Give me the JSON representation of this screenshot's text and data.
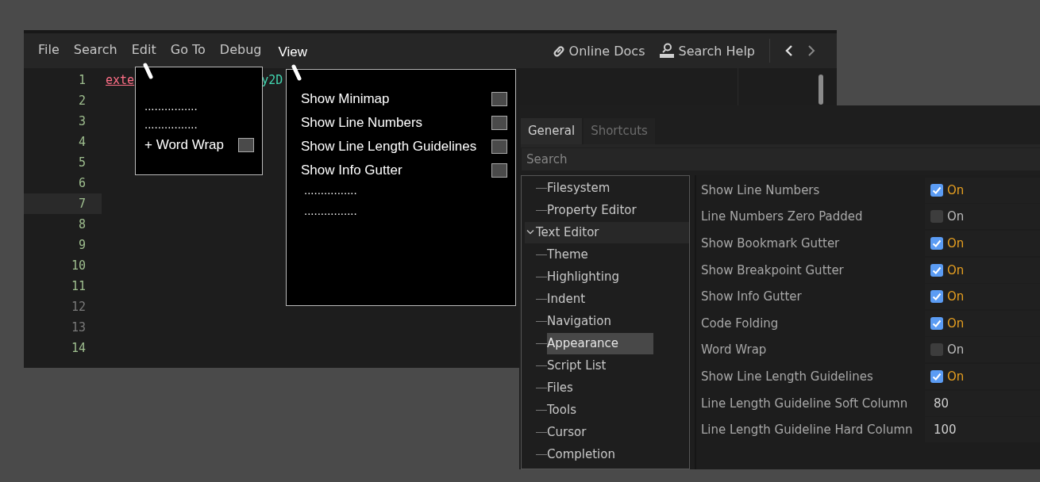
{
  "editor": {
    "menu": [
      {
        "label": "File"
      },
      {
        "label": "Search"
      },
      {
        "label": "Edit"
      },
      {
        "label": "Go To"
      },
      {
        "label": "Debug"
      },
      {
        "label": "View"
      }
    ],
    "help_links": [
      {
        "kind": "link",
        "label": "Online Docs"
      },
      {
        "kind": "doc",
        "label": "Search Help"
      }
    ],
    "line_numbers": [
      {
        "text": "1",
        "color": "#9fbf8f",
        "selected": false
      },
      {
        "text": "2",
        "color": "#9fbf8f",
        "selected": false
      },
      {
        "text": "3",
        "color": "#9fbf8f",
        "selected": false
      },
      {
        "text": "4",
        "color": "#9fbf8f",
        "selected": false
      },
      {
        "text": "5",
        "color": "#9fbf8f",
        "selected": false
      },
      {
        "text": "6",
        "color": "#9fbf8f",
        "selected": false
      },
      {
        "text": "7",
        "color": "#9fbf8f",
        "selected": true
      },
      {
        "text": "8",
        "color": "#9fbf8f",
        "selected": false
      },
      {
        "text": "9",
        "color": "#9fbf8f",
        "selected": false
      },
      {
        "text": "10",
        "color": "#9fbf8f",
        "selected": false
      },
      {
        "text": "11",
        "color": "#9fbf8f",
        "selected": false
      },
      {
        "text": "12",
        "color": "#7a7a7a",
        "selected": false
      },
      {
        "text": "13",
        "color": "#7a7a7a",
        "selected": false
      },
      {
        "text": "14",
        "color": "#9fbf8f",
        "selected": false
      }
    ],
    "code_line_1": {
      "keyword": "exte",
      "type": "y2D"
    }
  },
  "edit_popup": {
    "items": [
      {
        "kind": "dots",
        "label": "................"
      },
      {
        "kind": "dots",
        "label": "................"
      },
      {
        "kind": "check",
        "label": "+ Word Wrap",
        "checked": false
      }
    ]
  },
  "view_popup": {
    "items": [
      {
        "kind": "check",
        "label": "Show Minimap",
        "checked": false
      },
      {
        "kind": "check",
        "label": "Show Line Numbers",
        "checked": false
      },
      {
        "kind": "check",
        "label": "Show Line Length Guidelines",
        "checked": false
      },
      {
        "kind": "check",
        "label": "Show Info Gutter",
        "checked": false
      },
      {
        "kind": "dots",
        "label": "................"
      },
      {
        "kind": "dots",
        "label": "................"
      }
    ]
  },
  "settings": {
    "tabs": [
      {
        "label": "General",
        "selected": true
      },
      {
        "label": "Shortcuts",
        "selected": false
      }
    ],
    "search": {
      "placeholder": "Search"
    },
    "tree": [
      {
        "label": "Filesystem",
        "selected": false
      },
      {
        "label": "Property Editor",
        "selected": false
      },
      {
        "label": "Text Editor",
        "expanded": true,
        "selected": false,
        "children": [
          {
            "label": "Theme",
            "selected": false
          },
          {
            "label": "Highlighting",
            "selected": false
          },
          {
            "label": "Indent",
            "selected": false
          },
          {
            "label": "Navigation",
            "selected": false
          },
          {
            "label": "Appearance",
            "selected": true
          },
          {
            "label": "Script List",
            "selected": false
          },
          {
            "label": "Files",
            "selected": false
          },
          {
            "label": "Tools",
            "selected": false
          },
          {
            "label": "Cursor",
            "selected": false
          },
          {
            "label": "Completion",
            "selected": false
          }
        ]
      }
    ],
    "properties": [
      {
        "kind": "check",
        "label": "Show Line Numbers",
        "checked": true,
        "value": "On"
      },
      {
        "kind": "check",
        "label": "Line Numbers Zero Padded",
        "checked": false,
        "value": "On"
      },
      {
        "kind": "check",
        "label": "Show Bookmark Gutter",
        "checked": true,
        "value": "On"
      },
      {
        "kind": "check",
        "label": "Show Breakpoint Gutter",
        "checked": true,
        "value": "On"
      },
      {
        "kind": "check",
        "label": "Show Info Gutter",
        "checked": true,
        "value": "On"
      },
      {
        "kind": "check",
        "label": "Code Folding",
        "checked": true,
        "value": "On"
      },
      {
        "kind": "check",
        "label": "Word Wrap",
        "checked": false,
        "value": "On"
      },
      {
        "kind": "check",
        "label": "Show Line Length Guidelines",
        "checked": true,
        "value": "On"
      },
      {
        "kind": "number",
        "label": "Line Length Guideline Soft Column",
        "value": "80"
      },
      {
        "kind": "number",
        "label": "Line Length Guideline Hard Column",
        "value": "100"
      }
    ]
  }
}
